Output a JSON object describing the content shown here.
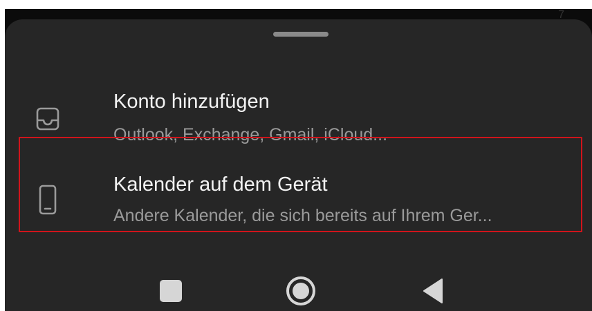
{
  "background": {
    "badge_text": "7"
  },
  "sheet": {
    "items": [
      {
        "icon": "inbox-tray-icon",
        "title": "Konto hinzufügen",
        "subtitle": "Outlook, Exchange, Gmail, iCloud..."
      },
      {
        "icon": "phone-device-icon",
        "title": "Kalender auf dem Gerät",
        "subtitle": "Andere Kalender, die sich bereits auf Ihrem Ger..."
      }
    ]
  },
  "navbar": {
    "buttons": [
      "recents-icon",
      "home-icon",
      "back-icon"
    ]
  },
  "colors": {
    "sheet_bg": "#262626",
    "title_text": "#f2f2f2",
    "subtitle_text": "#9a9a9a",
    "highlight_border": "#d0141b",
    "nav_icon": "#d6d6d6"
  }
}
